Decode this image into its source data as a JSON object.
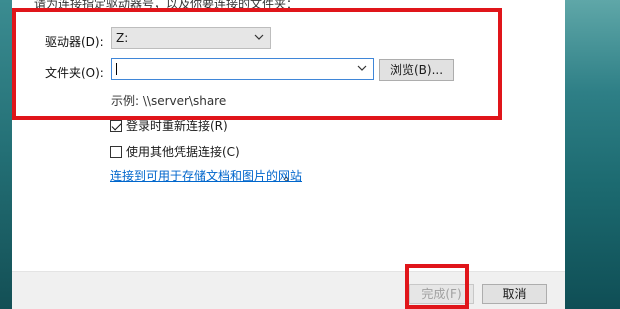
{
  "dialog": {
    "top_text": "请为连接指定驱动器号，以及你要连接的文件夹：",
    "drive": {
      "label": "驱动器(D):",
      "value": "Z:"
    },
    "folder": {
      "label": "文件夹(O):",
      "value": "",
      "browse_label": "浏览(B)..."
    },
    "example": "示例: \\\\server\\share",
    "reconnect": {
      "label": "登录时重新连接(R)",
      "checked": true
    },
    "credentials": {
      "label": "使用其他凭据连接(C)",
      "checked": false
    },
    "link_text": "连接到可用于存储文档和图片的网站",
    "link_suffix": "。",
    "finish_label": "完成(F)",
    "cancel_label": "取消"
  },
  "annotation_color": "#e0151a"
}
